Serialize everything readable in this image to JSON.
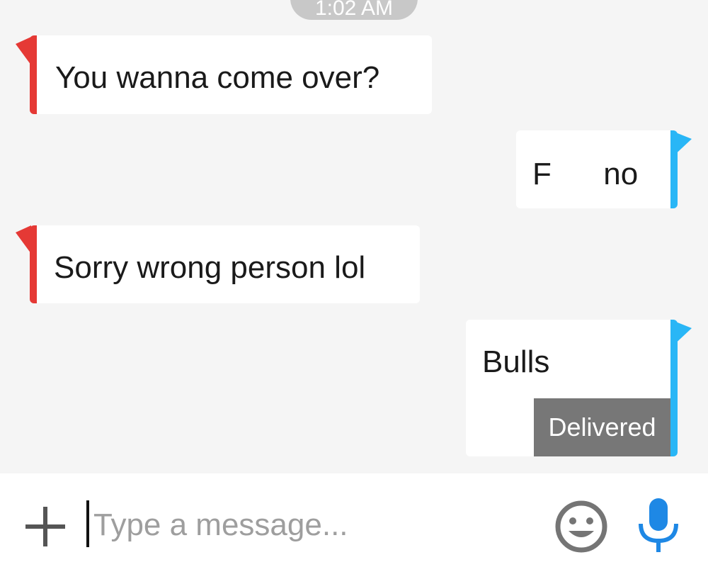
{
  "header": {
    "timestamp": "1:02 AM"
  },
  "messages": [
    {
      "direction": "incoming",
      "text": "You wanna come over?"
    },
    {
      "direction": "outgoing",
      "text": "F      no"
    },
    {
      "direction": "incoming",
      "text": "Sorry wrong person lol"
    },
    {
      "direction": "outgoing",
      "text": "Bulls",
      "status": "Delivered"
    }
  ],
  "composer": {
    "placeholder": "Type a message...",
    "value": "",
    "icons": [
      "plus-icon",
      "emoji-icon",
      "microphone-icon"
    ]
  },
  "colors": {
    "incoming_accent": "#e53935",
    "outgoing_accent": "#29b6f6",
    "chat_background": "#f5f5f5",
    "bubble_background": "#ffffff",
    "delivered_badge": "#777777",
    "mic_icon": "#1e88e5",
    "emoji_icon": "#757575"
  }
}
